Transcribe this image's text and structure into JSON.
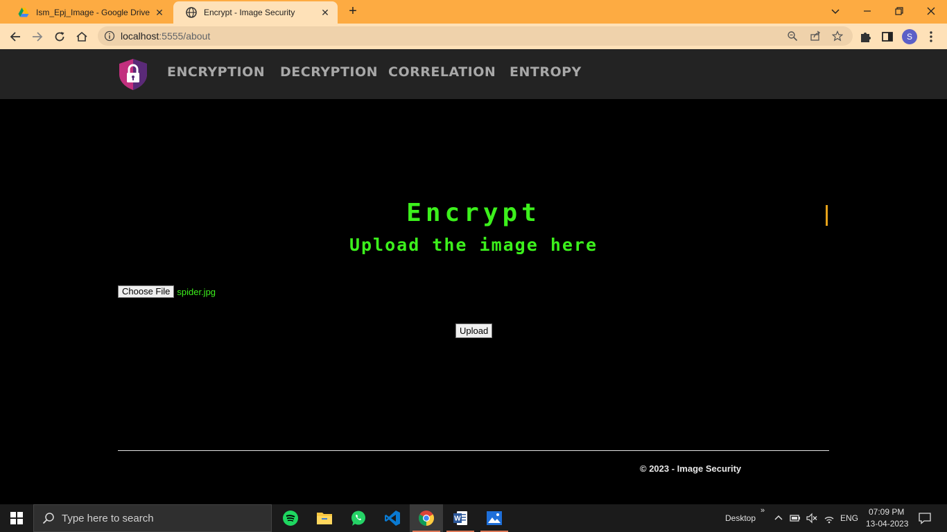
{
  "browser": {
    "tabs": [
      {
        "title": "Ism_Epj_Image - Google Drive",
        "icon": "google-drive-icon",
        "active": false
      },
      {
        "title": "Encrypt - Image Security",
        "icon": "globe-icon",
        "active": true
      }
    ],
    "url_host": "localhost",
    "url_path": ":5555/about",
    "profile_initial": "S"
  },
  "site": {
    "nav": [
      "ENCRYPTION",
      "DECRYPTION",
      "CORRELATION",
      "ENTROPY"
    ],
    "heading": "Encrypt",
    "subheading": "Upload the image here",
    "file_button": "Choose File",
    "file_name": "spider.jpg",
    "upload_button": "Upload",
    "footer": "© 2023 - Image Security"
  },
  "taskbar": {
    "search_placeholder": "Type here to search",
    "desktop_label": "Desktop",
    "desktop_chevron": "»",
    "language": "ENG",
    "time": "07:09 PM",
    "date": "13-04-2023",
    "apps": [
      "spotify-icon",
      "file-explorer-icon",
      "whatsapp-icon",
      "vscode-icon",
      "chrome-icon",
      "word-icon",
      "photos-icon"
    ]
  },
  "colors": {
    "accent_green": "#3cf01c",
    "chrome_orange": "#fdab42",
    "nav_bg": "#232323"
  }
}
